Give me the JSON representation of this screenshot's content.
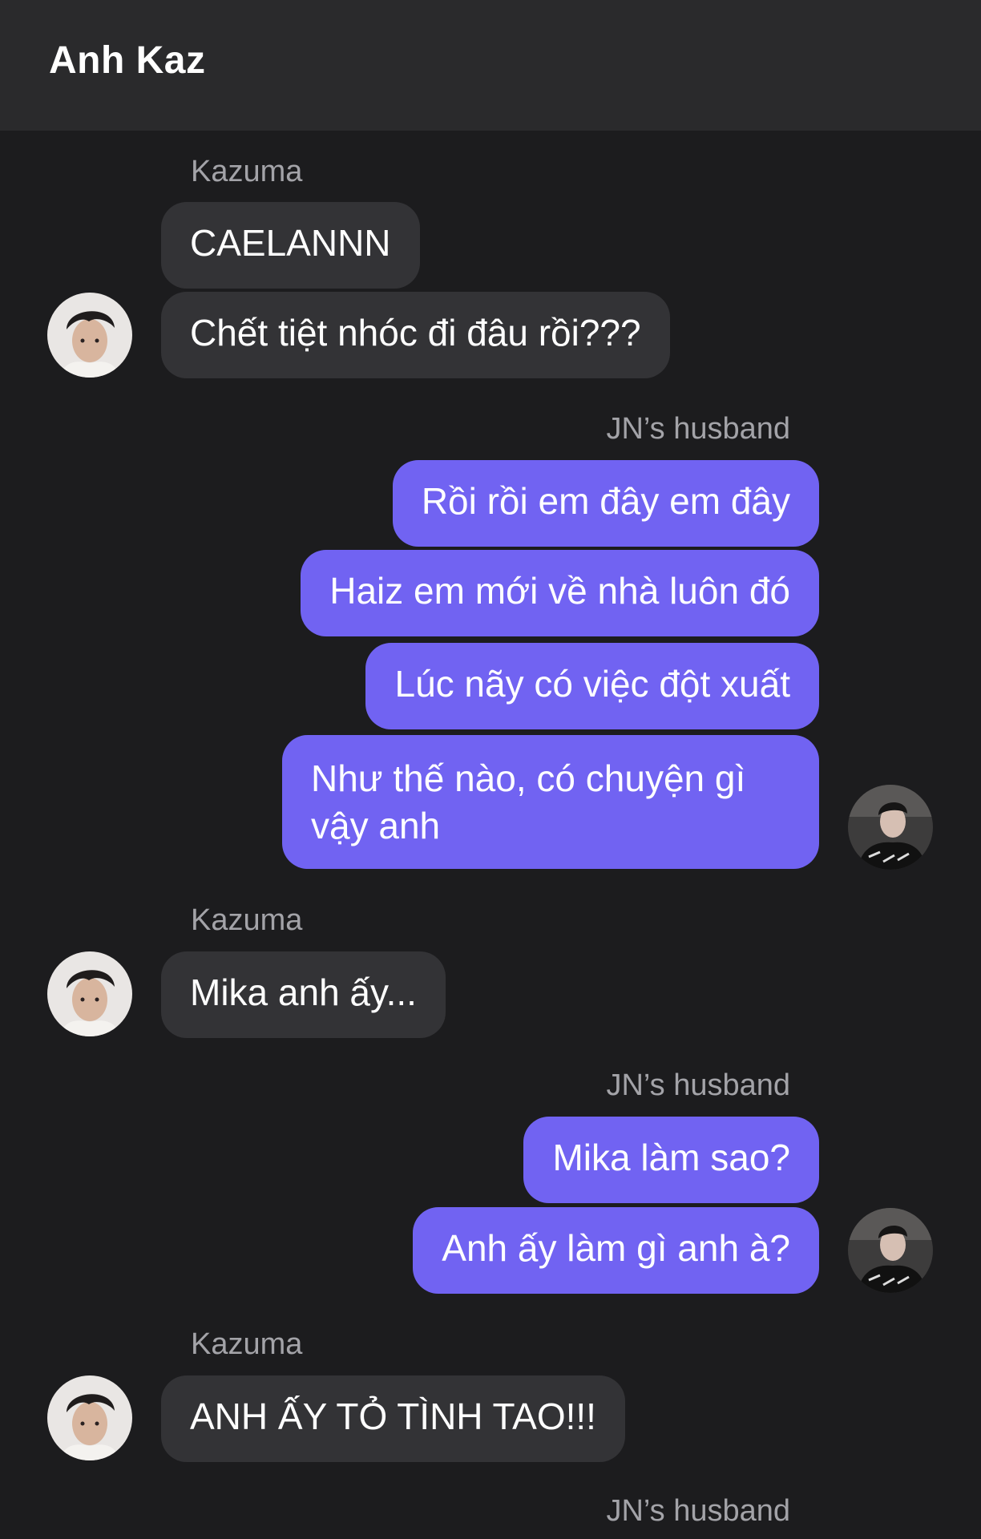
{
  "header": {
    "title": "Anh Kaz"
  },
  "senders": {
    "kazuma": "Kazuma",
    "jn_husband": "JN’s husband"
  },
  "messages": [
    {
      "from": "kazuma",
      "text": "CAELANNN"
    },
    {
      "from": "kazuma",
      "text": "Chết tiệt nhóc đi đâu rồi???"
    },
    {
      "from": "jn_husband",
      "text": "Rồi rồi em đây em đây"
    },
    {
      "from": "jn_husband",
      "text": "Haiz em mới về nhà luôn đó"
    },
    {
      "from": "jn_husband",
      "text": "Lúc nãy có việc đột xuất"
    },
    {
      "from": "jn_husband",
      "text": "Như thế nào, có chuyện gì vậy anh"
    },
    {
      "from": "kazuma",
      "text": "Mika anh ấy..."
    },
    {
      "from": "jn_husband",
      "text": "Mika làm sao?"
    },
    {
      "from": "jn_husband",
      "text": "Anh ấy làm gì anh à?"
    },
    {
      "from": "kazuma",
      "text": "ANH ẤY TỎ TÌNH TAO!!!"
    }
  ],
  "colors": {
    "background": "#1c1c1e",
    "header": "#2a2a2c",
    "incoming_bubble": "#333336",
    "outgoing_bubble": "#7163f2",
    "sender_label": "#a3a3a8"
  },
  "icons": {
    "kazuma_avatar": "kazuma-avatar-icon",
    "jn_husband_avatar": "jn-husband-avatar-icon"
  }
}
